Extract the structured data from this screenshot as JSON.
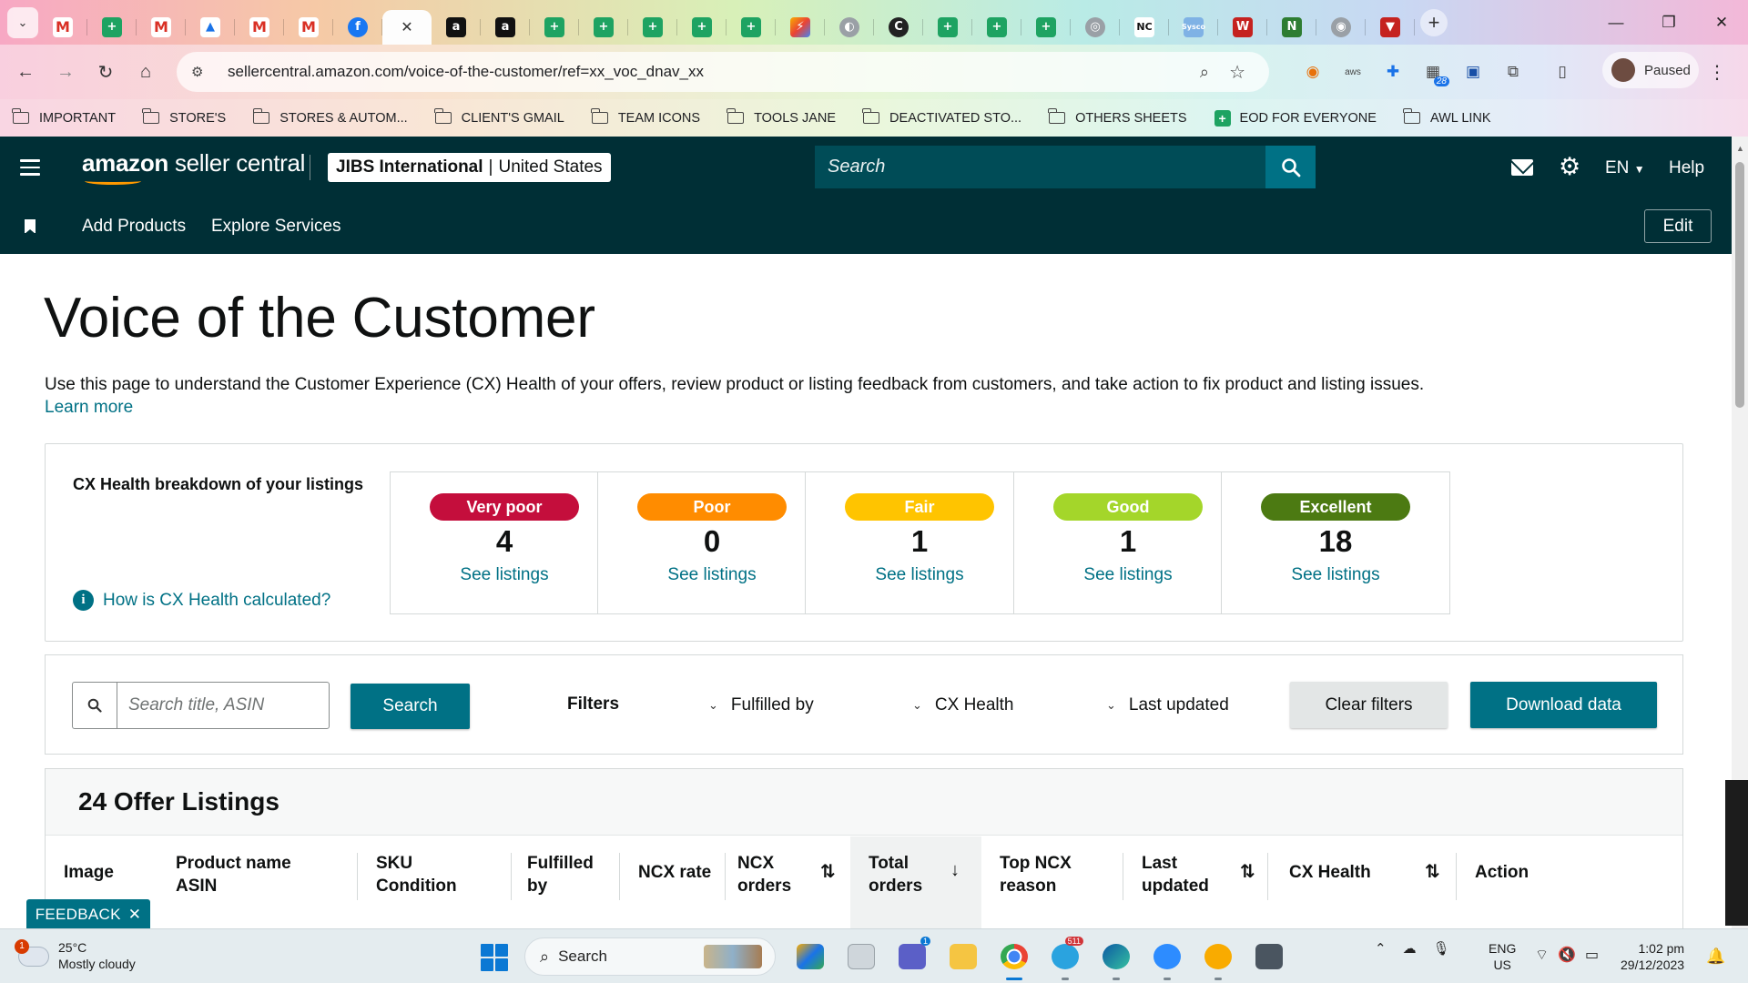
{
  "browser": {
    "tabs": [
      {
        "icon": "gmail-icon",
        "glyph": "M",
        "style": "gmail"
      },
      {
        "icon": "sheets-icon",
        "glyph": "+",
        "style": "sheets"
      },
      {
        "icon": "gmail-icon",
        "glyph": "M",
        "style": "gmail"
      },
      {
        "icon": "drive-icon",
        "glyph": "▲",
        "style": "drive"
      },
      {
        "icon": "gmail-icon",
        "glyph": "M",
        "style": "gmail"
      },
      {
        "icon": "gmail-icon",
        "glyph": "M",
        "style": "gmail"
      },
      {
        "icon": "facebook-icon",
        "glyph": "f",
        "style": "fb"
      },
      {
        "icon": "close-icon",
        "glyph": "✕",
        "style": "close",
        "active": true
      },
      {
        "icon": "amazon-icon",
        "glyph": "a",
        "style": "amz"
      },
      {
        "icon": "amazon-icon",
        "glyph": "a",
        "style": "amz"
      },
      {
        "icon": "sheets-icon",
        "glyph": "+",
        "style": "sheets"
      },
      {
        "icon": "sheets-icon",
        "glyph": "+",
        "style": "sheets"
      },
      {
        "icon": "sheets-icon",
        "glyph": "+",
        "style": "sheets"
      },
      {
        "icon": "sheets-icon",
        "glyph": "+",
        "style": "sheets"
      },
      {
        "icon": "sheets-icon",
        "glyph": "+",
        "style": "sheets"
      },
      {
        "icon": "colorful-app-icon",
        "glyph": "⚡",
        "style": "multi"
      },
      {
        "icon": "globe-icon",
        "glyph": "◐",
        "style": "grey"
      },
      {
        "icon": "c-logo-icon",
        "glyph": "C",
        "style": "dark"
      },
      {
        "icon": "sheets-icon",
        "glyph": "+",
        "style": "sheets"
      },
      {
        "icon": "sheets-icon",
        "glyph": "+",
        "style": "sheets"
      },
      {
        "icon": "sheets-icon",
        "glyph": "+",
        "style": "sheets"
      },
      {
        "icon": "badge-logo-icon",
        "glyph": "◎",
        "style": "grey"
      },
      {
        "icon": "nc-logo-icon",
        "glyph": "NC",
        "style": "nc"
      },
      {
        "icon": "sysco-logo-icon",
        "glyph": "Sysco",
        "style": "pale"
      },
      {
        "icon": "ww-logo-icon",
        "glyph": "W",
        "style": "red"
      },
      {
        "icon": "n-logo-icon",
        "glyph": "N",
        "style": "green2"
      },
      {
        "icon": "round-logo-icon",
        "glyph": "◉",
        "style": "grey"
      },
      {
        "icon": "v-logo-icon",
        "glyph": "▼",
        "style": "red"
      }
    ],
    "url": "sellercentral.amazon.com/voice-of-the-customer/ref=xx_voc_dnav_xx",
    "profile_label": "Paused",
    "extension_badge": "28",
    "bookmarks": [
      {
        "label": "IMPORTANT",
        "type": "folder"
      },
      {
        "label": "STORE'S",
        "type": "folder"
      },
      {
        "label": "STORES & AUTOM...",
        "type": "folder"
      },
      {
        "label": "CLIENT'S GMAIL",
        "type": "folder"
      },
      {
        "label": "TEAM ICONS",
        "type": "folder"
      },
      {
        "label": "TOOLS JANE",
        "type": "folder"
      },
      {
        "label": "DEACTIVATED STO...",
        "type": "folder"
      },
      {
        "label": "OTHERS SHEETS",
        "type": "folder"
      },
      {
        "label": "EOD FOR EVERYONE",
        "type": "sheet"
      },
      {
        "label": "AWL LINK",
        "type": "folder"
      }
    ]
  },
  "header": {
    "logo_bold": "amazon",
    "logo_rest": " seller central",
    "account_name": "JIBS International",
    "account_region": "United States",
    "search_placeholder": "Search",
    "language": "EN",
    "help": "Help"
  },
  "subnav": {
    "links": [
      "Add Products",
      "Explore Services"
    ],
    "edit": "Edit"
  },
  "page": {
    "title": "Voice of the Customer",
    "description": "Use this page to understand the Customer Experience (CX) Health of your offers, review product or listing feedback from customers, and take action to fix product and listing issues.",
    "learn_more": "Learn more"
  },
  "health": {
    "heading": "CX Health breakdown of your listings",
    "help_link": "How is CX Health calculated?",
    "tiles": [
      {
        "label": "Very poor",
        "count": "4",
        "link": "See listings",
        "color": "#c40e3c"
      },
      {
        "label": "Poor",
        "count": "0",
        "link": "See listings",
        "color": "#ff8c00"
      },
      {
        "label": "Fair",
        "count": "1",
        "link": "See listings",
        "color": "#ffc400"
      },
      {
        "label": "Good",
        "count": "1",
        "link": "See listings",
        "color": "#a4d62a"
      },
      {
        "label": "Excellent",
        "count": "18",
        "link": "See listings",
        "color": "#4c7a12"
      }
    ]
  },
  "filters": {
    "search_placeholder": "Search title, ASIN",
    "search_button": "Search",
    "label": "Filters",
    "dropdowns": [
      "Fulfilled by",
      "CX Health",
      "Last updated"
    ],
    "clear": "Clear filters",
    "download": "Download data"
  },
  "listings": {
    "title": "24 Offer Listings",
    "columns": [
      {
        "label": "Image"
      },
      {
        "label": "Product name ASIN",
        "line1": "Product name",
        "line2": "ASIN"
      },
      {
        "label": "SKU Condition",
        "line1": "SKU",
        "line2": "Condition"
      },
      {
        "label": "Fulfilled by",
        "line1": "Fulfilled",
        "line2": "by"
      },
      {
        "label": "NCX rate"
      },
      {
        "label": "NCX orders",
        "line1": "NCX",
        "line2": "orders"
      },
      {
        "label": "Total orders",
        "line1": "Total",
        "line2": "orders"
      },
      {
        "label": "Top NCX reason",
        "line1": "Top NCX",
        "line2": "reason"
      },
      {
        "label": "Last updated",
        "line1": "Last",
        "line2": "updated"
      },
      {
        "label": "CX Health"
      },
      {
        "label": "Action"
      }
    ]
  },
  "feedback_tab": "FEEDBACK",
  "taskbar": {
    "temperature": "25°C",
    "weather": "Mostly cloudy",
    "weather_badge": "1",
    "search": "Search",
    "lang1": "ENG",
    "lang2": "US",
    "time": "1:02 pm",
    "date": "29/12/2023",
    "app_badges": {
      "teams": "1",
      "telegram": "511"
    }
  }
}
